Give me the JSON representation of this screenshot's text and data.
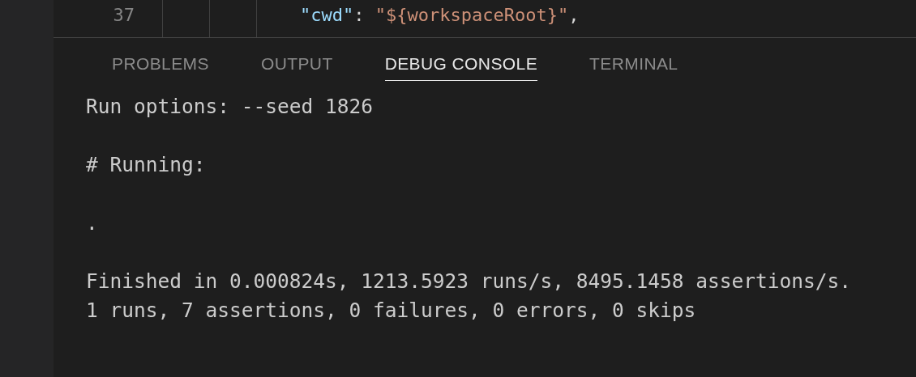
{
  "editor": {
    "lines": [
      {
        "number": "37",
        "tokens": [
          {
            "kind": "key",
            "text": "\"cwd\""
          },
          {
            "kind": "plain",
            "text": ": "
          },
          {
            "kind": "string",
            "text": "\"${workspaceRoot}\""
          },
          {
            "kind": "plain",
            "text": ","
          }
        ]
      }
    ]
  },
  "panel": {
    "tabs": [
      {
        "label": "PROBLEMS",
        "selected": false
      },
      {
        "label": "OUTPUT",
        "selected": false
      },
      {
        "label": "DEBUG CONSOLE",
        "selected": true
      },
      {
        "label": "TERMINAL",
        "selected": false
      }
    ],
    "console": {
      "blocks": [
        [
          "Run options: --seed 1826"
        ],
        [
          "# Running:"
        ],
        [
          "."
        ],
        [
          "Finished in 0.000824s, 1213.5923 runs/s, 8495.1458 assertions/s.",
          "1 runs, 7 assertions, 0 failures, 0 errors, 0 skips"
        ]
      ]
    }
  }
}
